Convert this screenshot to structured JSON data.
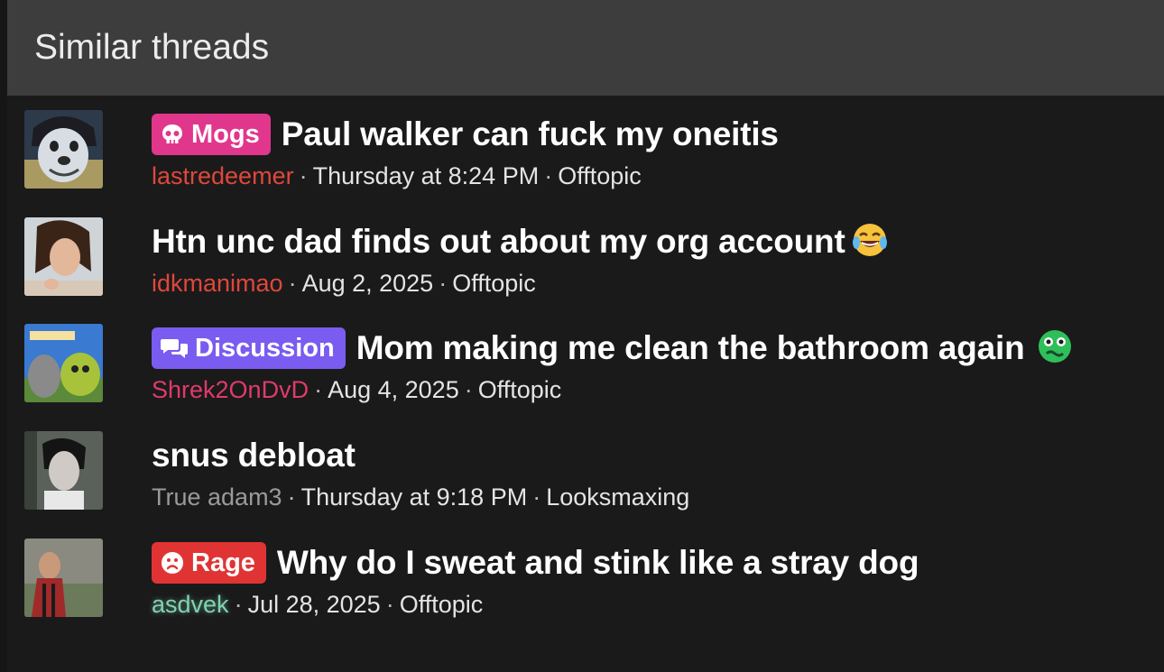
{
  "header": {
    "title": "Similar threads"
  },
  "threads": [
    {
      "badge": {
        "label": "Mogs",
        "color": "#e0378c",
        "icon": "skull-icon"
      },
      "title": "Paul walker can fuck my oneitis",
      "user": "lastredeemer",
      "user_color": "#e0473b",
      "date": "Thursday at 8:24 PM",
      "forum": "Offtopic"
    },
    {
      "badge": null,
      "title": "Htn unc dad finds out about my org account",
      "emoji": "laughing-crying-emoji",
      "user": "idkmanimao",
      "user_color": "#e0473b",
      "date": "Aug 2, 2025",
      "forum": "Offtopic"
    },
    {
      "badge": {
        "label": "Discussion",
        "color": "#7a5cf0",
        "icon": "chat-bubbles-icon"
      },
      "title": "Mom making me clean the bathroom again",
      "emoji": "nauseated-face-emoji",
      "user": "Shrek2OnDvD",
      "user_color": "#e03a6a",
      "date": "Aug 4, 2025",
      "forum": "Offtopic"
    },
    {
      "badge": null,
      "title": "snus debloat",
      "user": "True adam3",
      "user_color": "#9a9a9a",
      "date": "Thursday at 9:18 PM",
      "forum": "Looksmaxing"
    },
    {
      "badge": {
        "label": "Rage",
        "color": "#e03434",
        "icon": "frown-face-icon"
      },
      "title": "Why do I sweat and stink like a stray dog",
      "user": "asdvek",
      "user_color": "#7fd3b0",
      "date": "Jul 28, 2025",
      "forum": "Offtopic"
    }
  ],
  "separator": "·"
}
